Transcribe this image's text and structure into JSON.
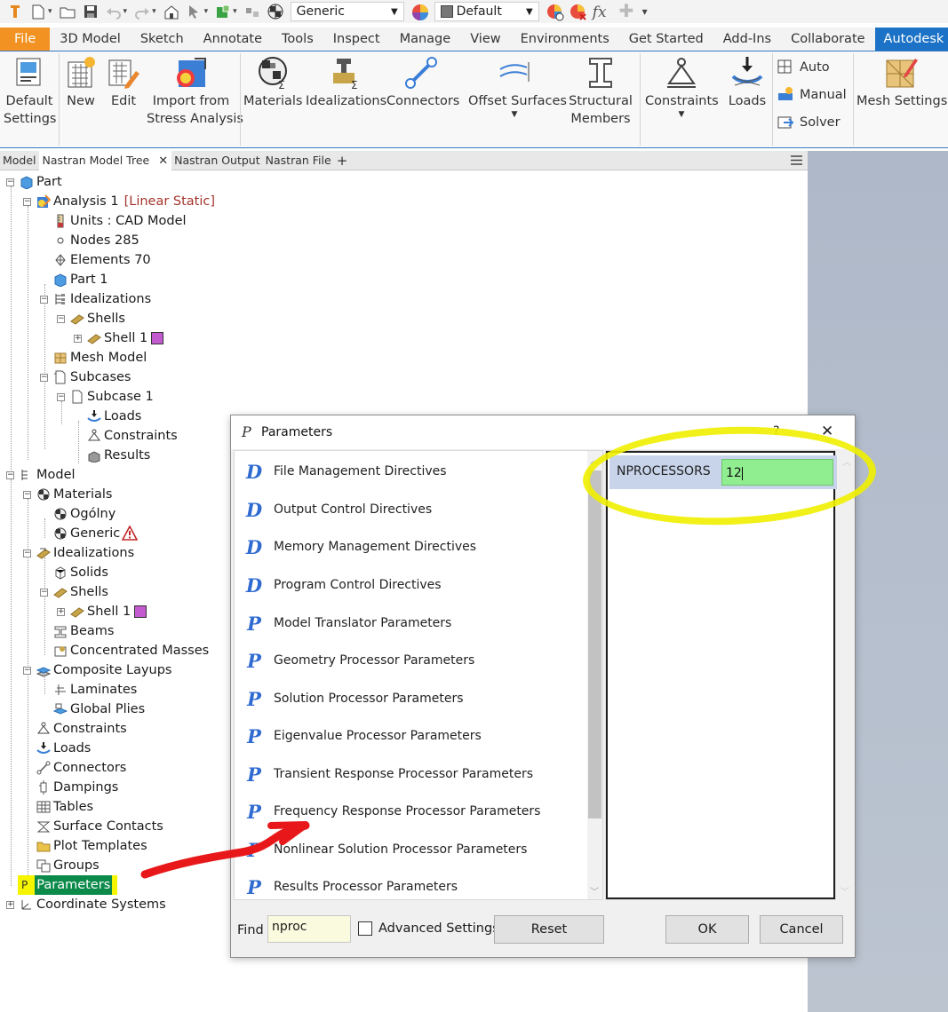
{
  "quick_access": {
    "style_select": "Generic",
    "appearance_select": "Default",
    "icons": [
      "inventor-logo-icon",
      "new-icon",
      "open-icon",
      "save-icon",
      "undo-icon",
      "redo-icon",
      "home-icon",
      "select-icon",
      "update-icon",
      "measure-icon",
      "material-sphere-icon",
      "appearance-icon",
      "clear-appearance-icon",
      "fx-parameters-icon",
      "plus-icon",
      "customize-icon"
    ]
  },
  "tabs": [
    "File",
    "3D Model",
    "Sketch",
    "Annotate",
    "Tools",
    "Inspect",
    "Manage",
    "View",
    "Environments",
    "Get Started",
    "Add-Ins",
    "Collaborate",
    "Autodesk Inven"
  ],
  "ribbon": {
    "default_settings": [
      "Default",
      "Settings"
    ],
    "new": "New",
    "edit": "Edit",
    "import_stress": [
      "Import from",
      "Stress Analysis"
    ],
    "materials": "Materials",
    "idealizations": "Idealizations",
    "connectors": "Connectors",
    "offset_surfaces": "Offset Surfaces",
    "structural_members": [
      "Structural",
      "Members"
    ],
    "constraints": "Constraints",
    "loads": "Loads",
    "auto": "Auto",
    "manual": "Manual",
    "solver": "Solver",
    "mesh_settings": "Mesh Settings"
  },
  "panel_tabs": [
    "Model",
    "Nastran Model Tree",
    "Nastran Output",
    "Nastran File"
  ],
  "tree": {
    "part": "Part",
    "analysis": "Analysis 1",
    "analysis_type": "[Linear Static]",
    "units": "Units : CAD Model",
    "nodes": "Nodes 285",
    "elements": "Elements 70",
    "part1": "Part 1",
    "idealizations": "Idealizations",
    "shells": "Shells",
    "shell1": "Shell 1",
    "mesh_model": "Mesh Model",
    "subcases": "Subcases",
    "subcase1": "Subcase 1",
    "loads": "Loads",
    "constraints": "Constraints",
    "results": "Results",
    "model": "Model",
    "materials": "Materials",
    "ogolny": "Ogólny",
    "generic": "Generic",
    "m_idealizations": "Idealizations",
    "solids": "Solids",
    "m_shells": "Shells",
    "m_shell1": "Shell 1",
    "beams": "Beams",
    "conc_masses": "Concentrated Masses",
    "composite": "Composite Layups",
    "laminates": "Laminates",
    "global_plies": "Global Plies",
    "m_constraints": "Constraints",
    "m_loads": "Loads",
    "connectors": "Connectors",
    "dampings": "Dampings",
    "tables": "Tables",
    "surface_contacts": "Surface Contacts",
    "plot_templates": "Plot Templates",
    "groups": "Groups",
    "parameters": "Parameters",
    "parameters_prefix": "P",
    "coord_systems": "Coordinate Systems"
  },
  "dialog": {
    "title_letter": "P",
    "title": "Parameters",
    "help": "?",
    "close": "✕",
    "items": [
      {
        "letter": "D",
        "label": "File Management Directives"
      },
      {
        "letter": "D",
        "label": "Output Control Directives"
      },
      {
        "letter": "D",
        "label": "Memory Management Directives"
      },
      {
        "letter": "D",
        "label": "Program Control Directives"
      },
      {
        "letter": "P",
        "label": "Model Translator Parameters"
      },
      {
        "letter": "P",
        "label": "Geometry Processor Parameters"
      },
      {
        "letter": "P",
        "label": "Solution Processor Parameters"
      },
      {
        "letter": "P",
        "label": "Eigenvalue Processor Parameters"
      },
      {
        "letter": "P",
        "label": "Transient Response Processor Parameters"
      },
      {
        "letter": "P",
        "label": "Frequency Response Processor Parameters"
      },
      {
        "letter": "P",
        "label": "Nonlinear Solution Processor Parameters"
      },
      {
        "letter": "P",
        "label": "Results Processor Parameters"
      }
    ],
    "param_name": "NPROCESSORS",
    "param_value": "12",
    "find_label": "Find",
    "find_value": "nproc",
    "advanced": "Advanced Settings",
    "reset": "Reset",
    "ok": "OK",
    "cancel": "Cancel"
  },
  "colors": {
    "file_tab": "#f29222",
    "active_tab": "#1c72c6",
    "highlight": "#f5f500",
    "annotation_red": "#e8181a",
    "param_value_bg": "#90ee90"
  }
}
